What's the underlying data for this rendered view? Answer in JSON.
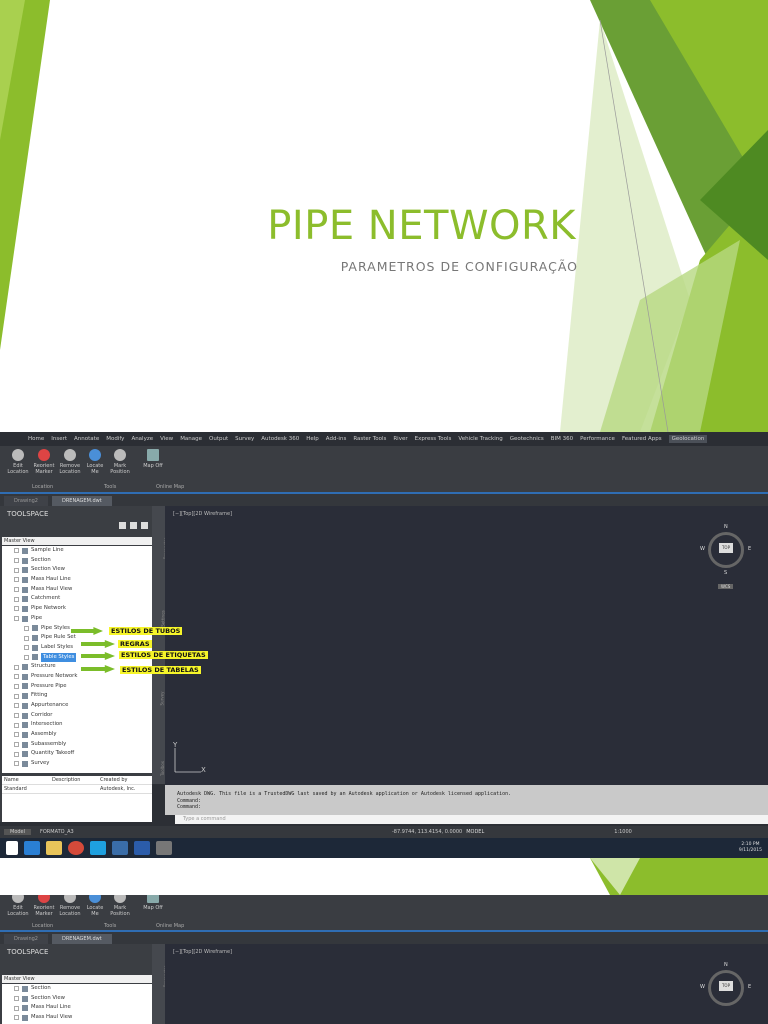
{
  "slide1": {
    "title": "PIPE NETWORK",
    "subtitle": "PARAMETROS DE CONFIGURAÇÃO"
  },
  "colors": {
    "accent": "#8cbd2c",
    "dark_green": "#5b9a2a",
    "light_green": "#c9e3a0",
    "annotation_bg": "#f6f52a"
  },
  "app": {
    "menu": [
      "Home",
      "Insert",
      "Annotate",
      "Modify",
      "Analyze",
      "View",
      "Manage",
      "Output",
      "Survey",
      "Autodesk 360",
      "Help",
      "Add-ins",
      "Raster Tools",
      "River",
      "Express Tools",
      "Vehicle Tracking",
      "Geotechnics",
      "BIM 360",
      "Performance",
      "Featured Apps",
      "Geolocation"
    ],
    "ribbon_buttons": [
      "Edit Location",
      "Reorient Marker",
      "Remove Location",
      "Locate Me",
      "Mark Position",
      "Map Off"
    ],
    "ribbon_groups": [
      "Location",
      "Tools",
      "Online Map"
    ],
    "doc_tabs": [
      "Drawing2",
      "DRENAGEM.dwt"
    ],
    "toolspace": {
      "title": "TOOLSPACE",
      "view": "Master View"
    },
    "tree": [
      "Sample Line",
      "Section",
      "Section View",
      "Mass Haul Line",
      "Mass Haul View",
      "Catchment",
      "Pipe Network",
      "Pipe",
      "Pipe Styles",
      "Pipe Rule Set",
      "Label Styles",
      "Table Styles",
      "Structure",
      "Pressure Network",
      "Pressure Pipe",
      "Fitting",
      "Appurtenance",
      "Corridor",
      "Intersection",
      "Assembly",
      "Subassembly",
      "Quantity Takeoff",
      "Survey"
    ],
    "tree2": [
      "Section",
      "Section View",
      "Mass Haul Line",
      "Mass Haul View"
    ],
    "grid": {
      "headers": [
        "Name",
        "Description",
        "Created by"
      ],
      "rows": [
        [
          "Standard",
          "",
          "Autodesk, Inc."
        ]
      ]
    },
    "palette_tabs": [
      "Prospector",
      "Settings",
      "Survey",
      "Toolbox"
    ],
    "viewport_label": "[−][Top][2D Wireframe]",
    "compass": {
      "top": "TOP",
      "n": "N",
      "s": "S",
      "e": "E",
      "w": "W",
      "wcs": "WCS"
    },
    "command_lines": [
      "Autodesk DWG.  This file is a TrustedDWG last saved by an Autodesk application or Autodesk licensed application.",
      "Command:",
      "Command:"
    ],
    "command_placeholder": "Type a command",
    "layout_tabs": [
      "Model",
      "FORMATO_A3"
    ],
    "coords": "-87.9744, 113.4154, 0.0000",
    "model": "MODEL",
    "scale": "1:1000",
    "clock": {
      "time": "2:10 PM",
      "date": "9/11/2015"
    }
  },
  "annotations": [
    "ESTILOS DE TUBOS",
    "REGRAS",
    "ESTILOS DE ETIQUETAS",
    "ESTILOS DE TABELAS"
  ]
}
